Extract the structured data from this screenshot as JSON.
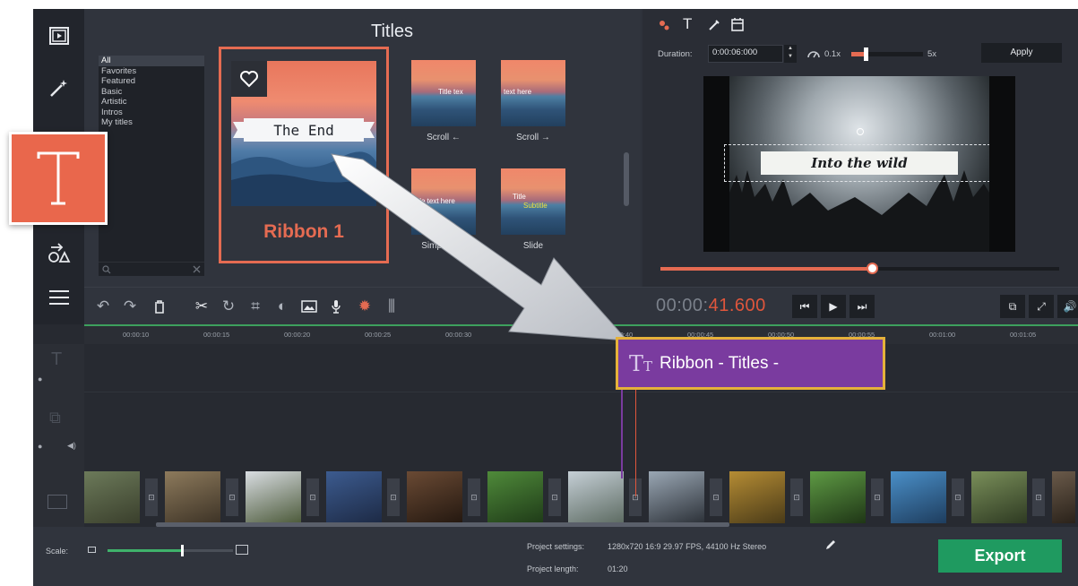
{
  "library": {
    "title": "Titles",
    "categories": [
      "All",
      "Favorites",
      "Featured",
      "Basic",
      "Artistic",
      "Intros",
      "My titles"
    ],
    "selected": {
      "label": "Ribbon 1",
      "text": "The End"
    },
    "thumbs": [
      {
        "label": "Scroll ←",
        "text": "Title tex"
      },
      {
        "label": "Scroll →",
        "text": "text here"
      },
      {
        "label": "Simple text",
        "text": "title text here"
      },
      {
        "label": "Slide",
        "text": "Title",
        "subtext": "Subtitle"
      }
    ]
  },
  "preview": {
    "duration_label": "Duration:",
    "duration_value": "0:00:06:000",
    "speed_min": "0.1x",
    "speed_max": "5x",
    "apply_label": "Apply",
    "video_title": "Into the wild",
    "progress": 0.53
  },
  "controls": {
    "time_main": "00:00:",
    "time_ms": "41.600"
  },
  "timeline": {
    "ticks": [
      "00:00:10",
      "00:00:15",
      "00:00:20",
      "00:00:25",
      "00:00:30",
      "00:00:40",
      "00:00:45",
      "00:00:50",
      "00:00:55",
      "00:01:00",
      "00:01:05"
    ],
    "title_clip_label": "Ribbon - Titles -"
  },
  "bottom": {
    "scale_label": "Scale:",
    "settings_label": "Project settings:",
    "settings_value": "1280x720 16:9 29.97 FPS, 44100 Hz Stereo",
    "length_label": "Project length:",
    "length_value": "01:20",
    "export_label": "Export"
  },
  "colors": {
    "accent": "#e56b52",
    "export": "#1f9a60",
    "title_clip": "#7a3b9f",
    "clip_border": "#e5b13a"
  }
}
